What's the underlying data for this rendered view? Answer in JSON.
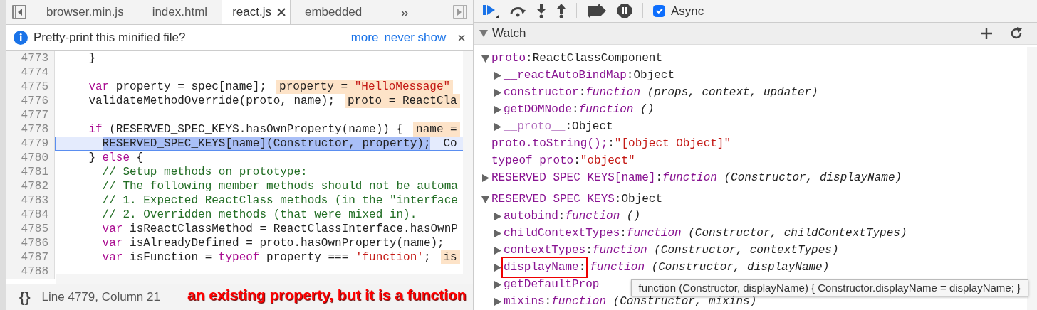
{
  "editor": {
    "tabs": [
      {
        "label": "browser.min.js",
        "selected": false,
        "closable": false
      },
      {
        "label": "index.html",
        "selected": false,
        "closable": false
      },
      {
        "label": "react.js",
        "selected": true,
        "closable": true
      },
      {
        "label": "embedded",
        "selected": false,
        "closable": false
      }
    ],
    "overflow_button": "»",
    "infobar": {
      "message": "Pretty-print this minified file?",
      "links": [
        "more",
        "never show"
      ],
      "close": "×"
    },
    "lines": [
      {
        "number": "4773",
        "current": false,
        "tokens": [
          {
            "kind": "plain",
            "text": "    }"
          }
        ]
      },
      {
        "number": "4774",
        "current": false
      },
      {
        "number": "4775",
        "current": false,
        "tokens": [
          {
            "kind": "keyword",
            "text": "    var"
          },
          {
            "kind": "plain",
            "text": " property = spec[name];"
          }
        ],
        "inline": [
          {
            "kind": "plain",
            "text": "property = "
          },
          {
            "kind": "string",
            "text": "\"HelloMessage\""
          }
        ]
      },
      {
        "number": "4776",
        "current": false,
        "tokens": [
          {
            "kind": "plain",
            "text": "    validateMethodOverride(proto, name);"
          }
        ],
        "inline": [
          {
            "kind": "plain",
            "text": "proto = ReactCla"
          }
        ]
      },
      {
        "number": "4777",
        "current": false
      },
      {
        "number": "4778",
        "current": false,
        "tokens": [
          {
            "kind": "keyword",
            "text": "    if"
          },
          {
            "kind": "plain",
            "text": " (RESERVED_SPEC_KEYS.hasOwnProperty(name)) {"
          }
        ],
        "inline": [
          {
            "kind": "plain",
            "text": "name ="
          }
        ]
      },
      {
        "number": "4779",
        "current": true,
        "tokens": [
          {
            "kind": "selection",
            "text": "      RESERVED_SPEC_KEYS[name](Constructor, property);"
          }
        ],
        "inline": [
          {
            "kind": "plain",
            "text": "Co"
          }
        ]
      },
      {
        "number": "4780",
        "current": false,
        "tokens": [
          {
            "kind": "plain",
            "text": "    } "
          },
          {
            "kind": "keyword",
            "text": "else"
          },
          {
            "kind": "plain",
            "text": " {"
          }
        ]
      },
      {
        "number": "4781",
        "current": false,
        "tokens": [
          {
            "kind": "comment",
            "text": "      // Setup methods on prototype:"
          }
        ]
      },
      {
        "number": "4782",
        "current": false,
        "tokens": [
          {
            "kind": "comment",
            "text": "      // The following member methods should not be automa"
          }
        ]
      },
      {
        "number": "4783",
        "current": false,
        "tokens": [
          {
            "kind": "comment",
            "text": "      // 1. Expected ReactClass methods (in the \"interface"
          }
        ]
      },
      {
        "number": "4784",
        "current": false,
        "tokens": [
          {
            "kind": "comment",
            "text": "      // 2. Overridden methods (that were mixed in)."
          }
        ]
      },
      {
        "number": "4785",
        "current": false,
        "tokens": [
          {
            "kind": "keyword",
            "text": "      var"
          },
          {
            "kind": "plain",
            "text": " isReactClassMethod = ReactClassInterface.hasOwnP"
          }
        ]
      },
      {
        "number": "4786",
        "current": false,
        "tokens": [
          {
            "kind": "keyword",
            "text": "      var"
          },
          {
            "kind": "plain",
            "text": " isAlreadyDefined = proto.hasOwnProperty(name);"
          }
        ]
      },
      {
        "number": "4787",
        "current": false,
        "tokens": [
          {
            "kind": "keyword",
            "text": "      var"
          },
          {
            "kind": "plain",
            "text": " isFunction = "
          },
          {
            "kind": "keyword",
            "text": "typeof"
          },
          {
            "kind": "plain",
            "text": " property === "
          },
          {
            "kind": "string",
            "text": "'function'"
          },
          {
            "kind": "plain",
            "text": ";"
          }
        ],
        "inline": [
          {
            "kind": "plain",
            "text": "is"
          }
        ]
      },
      {
        "number": "4788",
        "current": false
      }
    ],
    "status": "Line 4779, Column 21",
    "pretty_print_button": "{}"
  },
  "debugger": {
    "toolbar": {
      "async": {
        "label": "Async",
        "checked": true
      }
    },
    "watch": {
      "title": "Watch",
      "expanded": true,
      "items": [
        {
          "name": "proto",
          "sep": ":",
          "kind": "object",
          "value": "ReactClassComponent",
          "expanded": true,
          "children": [
            {
              "name": "__reactAutoBindMap",
              "sep": ":",
              "kind": "object",
              "value": "Object",
              "expanded": false
            },
            {
              "name": "constructor",
              "sep": ":",
              "kind": "function",
              "keyword": "function",
              "value": "(props, context, updater)",
              "expanded": false
            },
            {
              "name": "getDOMNode",
              "sep": ":",
              "kind": "function",
              "keyword": "function",
              "value": "()",
              "expanded": false
            },
            {
              "name": "__proto__",
              "sep": ":",
              "kind": "object",
              "value": "Object",
              "expanded": false,
              "dim": true
            }
          ]
        },
        {
          "name": "proto.toString();",
          "sep": ":",
          "kind": "string",
          "value": "\"[object Object]\""
        },
        {
          "name": "typeof proto",
          "sep": ":",
          "kind": "string",
          "value": "\"object\""
        },
        {
          "name": "RESERVED SPEC KEYS[name]",
          "sep": ":",
          "kind": "function",
          "keyword": "function",
          "value": "(Constructor, displayName)",
          "expanded": false
        },
        {
          "name": "RESERVED SPEC KEYS",
          "sep": ":",
          "kind": "object",
          "value": "Object",
          "expanded": true,
          "children": [
            {
              "name": "autobind",
              "sep": ":",
              "kind": "function",
              "keyword": "function",
              "value": "()",
              "expanded": false
            },
            {
              "name": "childContextTypes",
              "sep": ":",
              "kind": "function",
              "keyword": "function",
              "value": "(Constructor, childContextTypes)",
              "expanded": false
            },
            {
              "name": "contextTypes",
              "sep": ":",
              "kind": "function",
              "keyword": "function",
              "value": "(Constructor, contextTypes)",
              "expanded": false
            },
            {
              "name": "displayName",
              "sep": ":",
              "kind": "function",
              "keyword": "function",
              "value": "(Constructor, displayName)",
              "expanded": false,
              "marked": true
            },
            {
              "name": "getDefaultProp",
              "kind": "cut",
              "expanded": false
            },
            {
              "name": "mixins",
              "sep": ":",
              "kind": "function",
              "keyword": "function",
              "value": "(Constructor, mixins)",
              "expanded": false
            }
          ]
        }
      ]
    },
    "tooltip": "function (Constructor, displayName) { Constructor.displayName = displayName; }"
  },
  "annotation": "an existing property, but it is a function"
}
